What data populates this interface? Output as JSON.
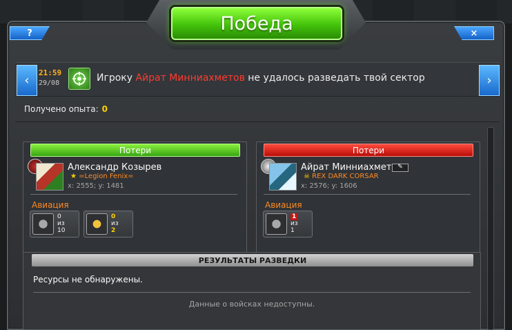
{
  "header": {
    "title": "Победа",
    "help_label": "?",
    "close_label": "×"
  },
  "event": {
    "time": "21:59",
    "date": "29/08",
    "message_prefix": "Игроку",
    "target_name": "Айрат Минниахметов",
    "message_suffix": "не удалось разведать твой сектор",
    "left_arrow": "‹",
    "right_arrow": "›"
  },
  "experience": {
    "label": "Получено опыта:",
    "value": "0"
  },
  "left_player": {
    "loss_label": "Потери",
    "name": "Александр Козырев",
    "clan": "=Legion Fenix=",
    "coordinates": "x: 2555; y: 1481",
    "section_label": "Авиация",
    "units": [
      {
        "count": "0",
        "of_label": "из",
        "total": "10"
      },
      {
        "count": "0",
        "of_label": "из",
        "total": "2"
      }
    ]
  },
  "right_player": {
    "loss_label": "Потери",
    "name": "Айрат Минниахметов",
    "clan": "REX DARK CORSAR",
    "coordinates": "x: 2576; y: 1606",
    "section_label": "Авиация",
    "units": [
      {
        "count": "1",
        "of_label": "из",
        "total": "1"
      }
    ]
  },
  "recon": {
    "title": "РЕЗУЛЬТАТЫ РАЗВЕДКИ",
    "resources_text": "Ресурсы не обнаружены.",
    "troops_text": "Данные о войсках недоступны."
  },
  "colors": {
    "victory_green": "#43c30a",
    "loss_red": "#b80e09",
    "accent_orange": "#ff8a24",
    "accent_yellow": "#ffd000"
  }
}
